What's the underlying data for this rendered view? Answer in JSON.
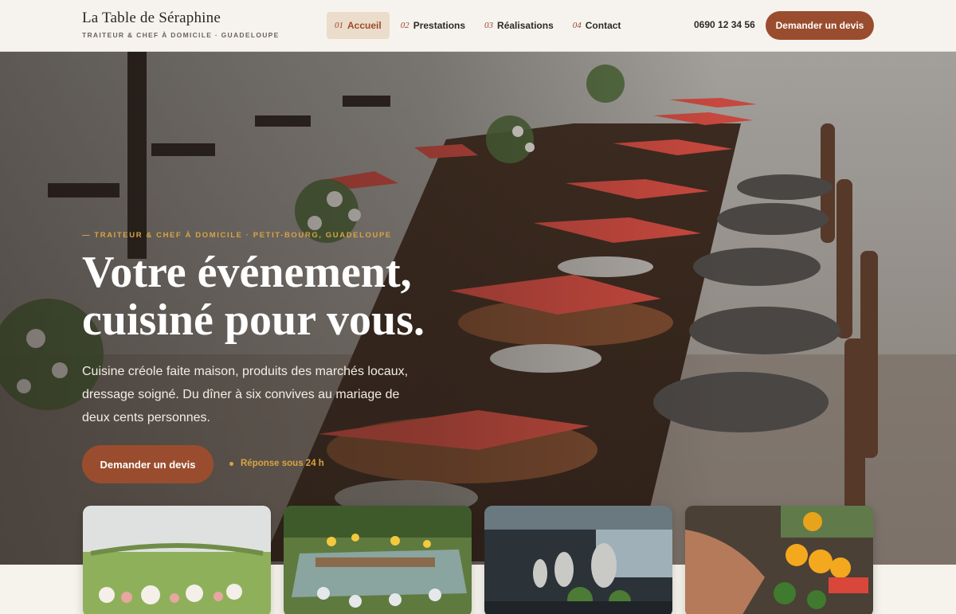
{
  "brand": {
    "name": "La Table de Séraphine",
    "tagline": "TRAITEUR & CHEF À DOMICILE · GUADELOUPE"
  },
  "nav": {
    "items": [
      {
        "num": "01",
        "label": "Accueil"
      },
      {
        "num": "02",
        "label": "Prestations"
      },
      {
        "num": "03",
        "label": "Réalisations"
      },
      {
        "num": "04",
        "label": "Contact"
      }
    ]
  },
  "header": {
    "phone": "0690 12 34 56",
    "cta_label": "Demander un devis"
  },
  "hero": {
    "eyebrow": "— TRAITEUR & CHEF À DOMICILE · PETIT-BOURG, GUADELOUPE",
    "title_line1": "Votre événement,",
    "title_line2": "cuisiné pour vous.",
    "text": "Cuisine créole faite maison, produits des marchés locaux, dressage soigné. Du dîner à six convives au mariage de deux cents personnes.",
    "cta_label": "Demander un devis",
    "note": "Réponse sous 24 h"
  },
  "colors": {
    "accent": "#9a4d2e",
    "gold": "#d8a441",
    "header_bg": "#f6f3ee"
  },
  "icons": {
    "note_dot": "dot-icon"
  }
}
